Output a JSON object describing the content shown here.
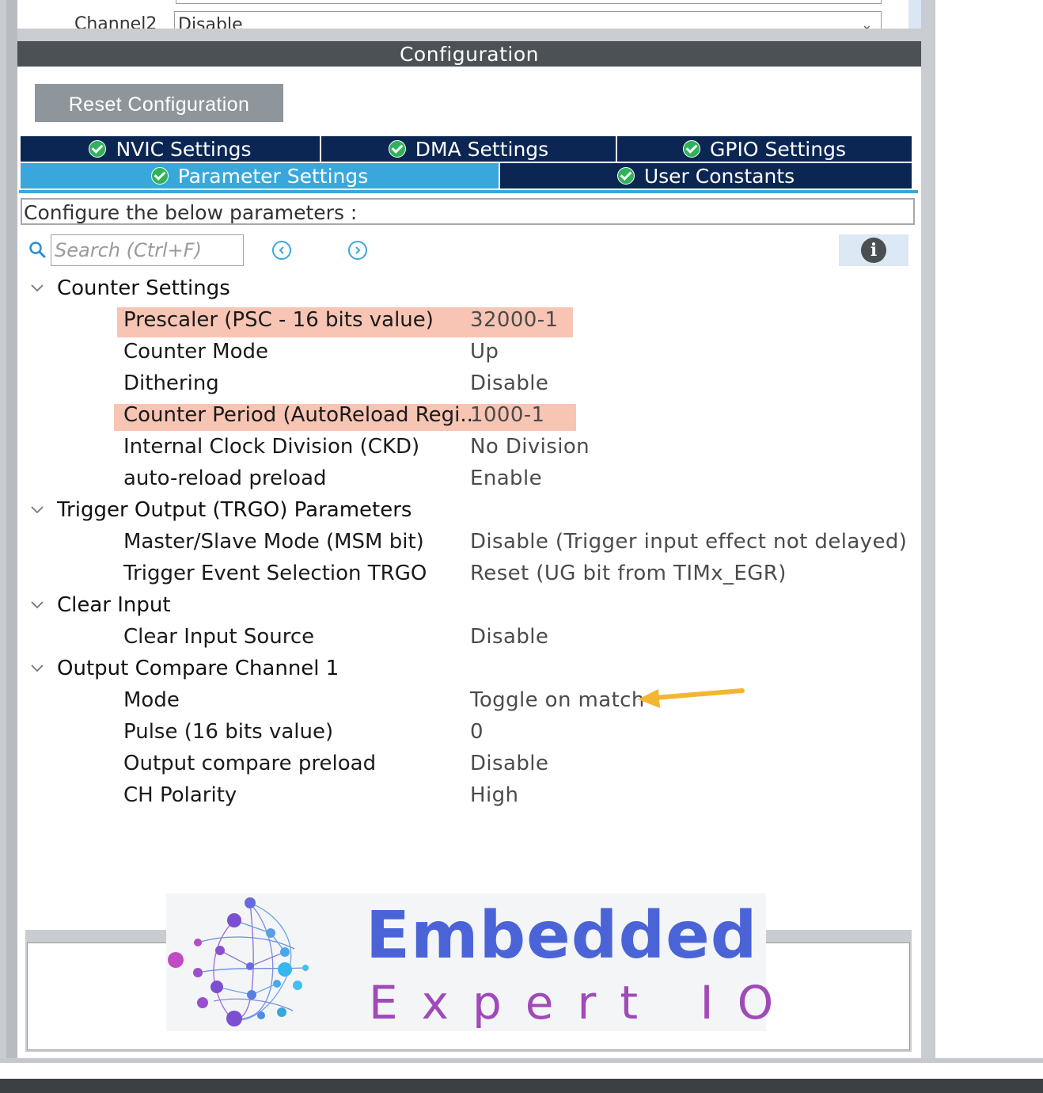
{
  "top_row": {
    "label": "Channel2",
    "value": "Disable"
  },
  "config": {
    "header": "Configuration",
    "reset_button": "Reset Configuration"
  },
  "tabs": [
    {
      "label": "NVIC Settings",
      "active": false
    },
    {
      "label": "DMA Settings",
      "active": false
    },
    {
      "label": "GPIO Settings",
      "active": false
    },
    {
      "label": "Parameter Settings",
      "active": true
    },
    {
      "label": "User Constants",
      "active": false
    }
  ],
  "describe_text": "Configure the below parameters :",
  "search": {
    "placeholder": "Search (Ctrl+F)"
  },
  "groups": [
    {
      "label": "Counter Settings",
      "params": [
        {
          "name": "Prescaler (PSC - 16 bits value)",
          "value": "32000-1",
          "highlighted": true
        },
        {
          "name": "Counter Mode",
          "value": "Up",
          "highlighted": false
        },
        {
          "name": "Dithering",
          "value": "Disable",
          "highlighted": false
        },
        {
          "name": "Counter Period (AutoReload Regi...",
          "value": "1000-1",
          "highlighted": true
        },
        {
          "name": "Internal Clock Division (CKD)",
          "value": "No Division",
          "highlighted": false
        },
        {
          "name": "auto-reload preload",
          "value": "Enable",
          "highlighted": false
        }
      ]
    },
    {
      "label": "Trigger Output (TRGO) Parameters",
      "params": [
        {
          "name": "Master/Slave Mode (MSM bit)",
          "value": "Disable (Trigger input effect not delayed)",
          "highlighted": false
        },
        {
          "name": "Trigger Event Selection TRGO",
          "value": "Reset (UG bit from TIMx_EGR)",
          "highlighted": false
        }
      ]
    },
    {
      "label": "Clear Input",
      "params": [
        {
          "name": "Clear Input Source",
          "value": "Disable",
          "highlighted": false
        }
      ]
    },
    {
      "label": "Output Compare Channel 1",
      "params": [
        {
          "name": "Mode",
          "value": "Toggle on match",
          "highlighted": false
        },
        {
          "name": "Pulse (16 bits value)",
          "value": "0",
          "highlighted": false
        },
        {
          "name": "Output compare preload",
          "value": "Disable",
          "highlighted": false
        },
        {
          "name": "CH Polarity",
          "value": "High",
          "highlighted": false
        }
      ]
    }
  ],
  "logo": {
    "line1": "Embedded",
    "line2": "Expert IO"
  },
  "colors": {
    "tab_inactive": "#0c2653",
    "tab_active": "#3aa7dc",
    "highlight": "#f8c4b4",
    "arrow": "#f2b632",
    "check": "#2fb35a"
  }
}
